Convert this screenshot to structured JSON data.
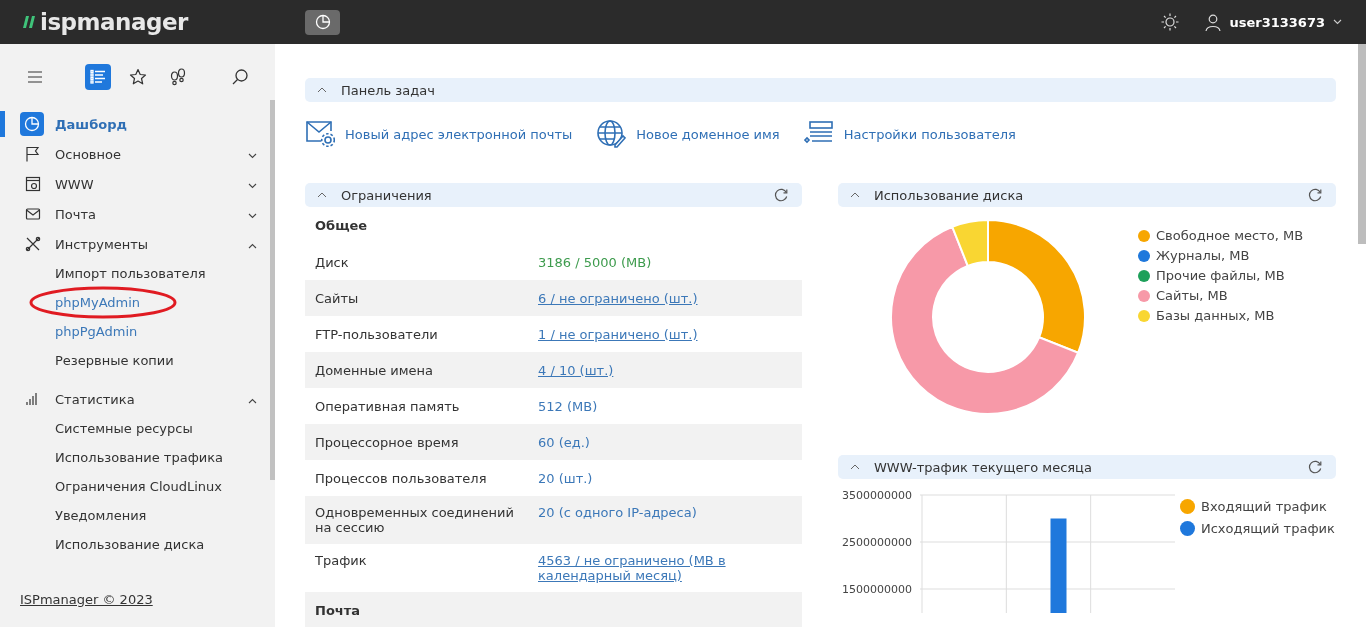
{
  "header": {
    "logo": "ispmanager",
    "user": "user3133673"
  },
  "sidebar": {
    "toolbar": [
      {
        "selected": false
      },
      {
        "selected": true
      },
      {
        "selected": false
      },
      {
        "selected": false
      },
      {
        "selected": false
      }
    ],
    "nav": [
      {
        "label": "Дашборд",
        "kind": "page",
        "selected": true
      },
      {
        "label": "Основное",
        "kind": "group",
        "selected": false,
        "expanded": false
      },
      {
        "label": "WWW",
        "kind": "group",
        "selected": false,
        "expanded": false
      },
      {
        "label": "Почта",
        "kind": "group",
        "selected": false,
        "expanded": false
      },
      {
        "label": "Инструменты",
        "kind": "group",
        "selected": false,
        "expanded": true,
        "children": [
          {
            "label": "Импорт пользователя",
            "external": false,
            "circled": false
          },
          {
            "label": "phpMyAdmin",
            "external": true,
            "circled": true
          },
          {
            "label": "phpPgAdmin",
            "external": true,
            "circled": false
          },
          {
            "label": "Резервные копии",
            "external": false,
            "circled": false
          }
        ]
      },
      {
        "label": "Статистика",
        "kind": "group",
        "selected": false,
        "expanded": true,
        "children": [
          {
            "label": "Системные ресурсы",
            "external": false,
            "circled": false
          },
          {
            "label": "Использование трафика",
            "external": false,
            "circled": false
          },
          {
            "label": "Ограничения CloudLinux",
            "external": false,
            "circled": false
          },
          {
            "label": "Уведомления",
            "external": false,
            "circled": false
          },
          {
            "label": "Использование диска",
            "external": false,
            "circled": false
          }
        ]
      }
    ],
    "footer": "ISPmanager © 2023"
  },
  "task_panel": {
    "title": "Панель задач",
    "expanded": true,
    "actions": [
      "Новый адрес электронной почты",
      "Новое доменное имя",
      "Настройки пользователя"
    ]
  },
  "limits": {
    "title": "Ограничения",
    "expanded": true,
    "rows": [
      {
        "kind": "section",
        "label": "Общее"
      },
      {
        "kind": "ok",
        "label": "Диск",
        "value": "3186 / 5000 (MB)"
      },
      {
        "kind": "link",
        "label": "Сайты",
        "value": "6 / не ограничено (шт.)"
      },
      {
        "kind": "link",
        "label": "FTP-пользователи",
        "value": "1 / не ограничено (шт.)"
      },
      {
        "kind": "link",
        "label": "Доменные имена",
        "value": "4 / 10 (шт.)"
      },
      {
        "kind": "text",
        "label": "Оперативная память",
        "value": "512 (MB)"
      },
      {
        "kind": "text",
        "label": "Процессорное время",
        "value": "60 (ед.)"
      },
      {
        "kind": "text",
        "label": "Процессов пользователя",
        "value": "20 (шт.)"
      },
      {
        "kind": "text",
        "label": "Одновременных соединений на сессию",
        "value": "20 (с одного IP-адреса)"
      },
      {
        "kind": "link",
        "label": "Трафик",
        "value": "4563 / не ограничено (MB в календарный месяц)"
      },
      {
        "kind": "section",
        "label": "Почта"
      }
    ]
  },
  "disk_usage": {
    "title": "Использование диска",
    "expanded": true,
    "legend": [
      {
        "label": "Свободное место, MB",
        "color": "#f7a600"
      },
      {
        "label": "Журналы, MB",
        "color": "#1f78dc"
      },
      {
        "label": "Прочие файлы, MB",
        "color": "#1ea05a"
      },
      {
        "label": "Сайты, MB",
        "color": "#f799a8"
      },
      {
        "label": "Базы данных, MB",
        "color": "#f9d632"
      }
    ]
  },
  "traffic": {
    "title": "WWW-трафик текущего месяца",
    "expanded": true,
    "chart_data": {
      "type": "bar",
      "yticks": [
        1500000000,
        2500000000,
        3500000000
      ],
      "ylim": [
        1000000000,
        3500000000
      ],
      "series": [
        {
          "name": "Входящий трафик",
          "color": "#f7a600",
          "values": [
            null,
            null,
            null
          ]
        },
        {
          "name": "Исходящий трафик",
          "color": "#1f78dc",
          "values": [
            null,
            3000000000,
            null
          ]
        }
      ]
    }
  }
}
